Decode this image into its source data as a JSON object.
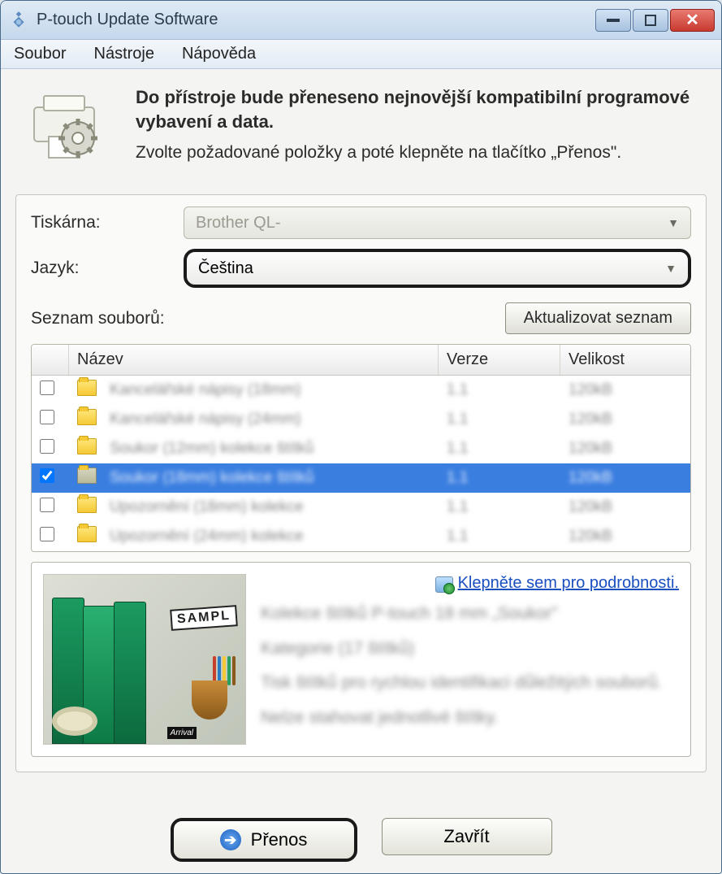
{
  "window": {
    "title": "P-touch Update Software"
  },
  "menu": {
    "items": [
      "Soubor",
      "Nástroje",
      "Nápověda"
    ]
  },
  "header": {
    "bold": "Do přístroje bude přeneseno nejnovější kompatibilní programové vybavení a data.",
    "plain": "Zvolte požadované položky a poté klepněte na tlačítko „Přenos\"."
  },
  "form": {
    "printer_label": "Tiskárna:",
    "printer_value": "Brother QL-",
    "language_label": "Jazyk:",
    "language_value": "Čeština"
  },
  "list": {
    "title": "Seznam souborů:",
    "refresh_btn": "Aktualizovat seznam",
    "columns": {
      "name": "Název",
      "version": "Verze",
      "size": "Velikost"
    },
    "rows": [
      {
        "checked": false,
        "selected": false,
        "icon": "folder",
        "name": "Kancelářské nápisy (18mm)",
        "ver": "1.1",
        "size": "120kB"
      },
      {
        "checked": false,
        "selected": false,
        "icon": "folder",
        "name": "Kancelářské nápisy (24mm)",
        "ver": "1.1",
        "size": "120kB"
      },
      {
        "checked": false,
        "selected": false,
        "icon": "folder",
        "name": "Soukor (12mm) kolekce štítků",
        "ver": "1.1",
        "size": "120kB"
      },
      {
        "checked": true,
        "selected": true,
        "icon": "folder-dim",
        "name": "Soukor (18mm) kolekce štítků",
        "ver": "1.1",
        "size": "120kB"
      },
      {
        "checked": false,
        "selected": false,
        "icon": "folder",
        "name": "Upozornění (18mm) kolekce",
        "ver": "1.1",
        "size": "120kB"
      },
      {
        "checked": false,
        "selected": false,
        "icon": "folder",
        "name": "Upozornění (24mm) kolekce",
        "ver": "1.1",
        "size": "120kB"
      }
    ]
  },
  "detail": {
    "link": "Klepněte sem pro podrobnosti.",
    "line1": "Kolekce štítků P-touch 18 mm „Soukor\"",
    "line2": "Kategorie (17 štítků)",
    "line3": "Tisk štítků pro rychlou identifikaci důležitých souborů.",
    "line4": "Nelze stahovat jednotlivé štítky."
  },
  "buttons": {
    "transfer": "Přenos",
    "close": "Zavřít"
  }
}
